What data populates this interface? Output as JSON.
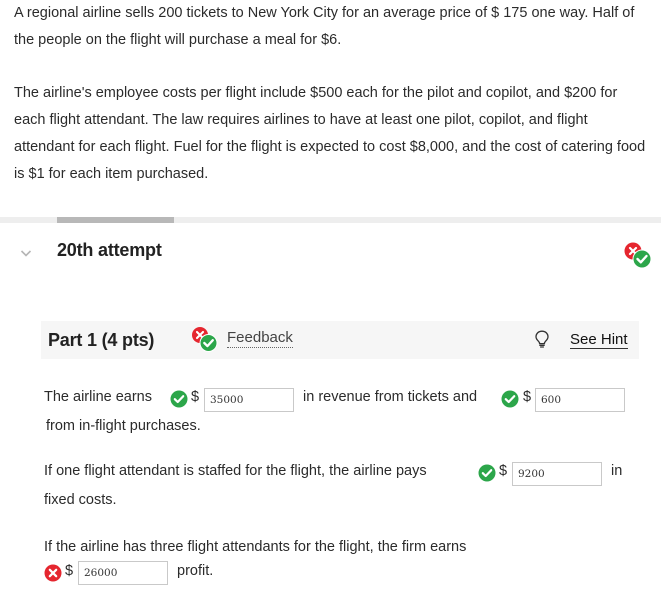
{
  "problem": {
    "paragraph1": "A regional airline sells 200 tickets to New York City for an average price of $ 175 one way. Half of the people on the flight will purchase a meal for $6.",
    "paragraph2": "The airline's employee costs per flight include $500 each for the pilot and copilot, and $200 for each flight attendant. The law requires airlines to have at least one pilot, copilot, and flight attendant for each flight. Fuel for the flight is expected to cost $8,000, and the cost of catering food is $1 for each item purchased."
  },
  "attempt": {
    "title": "20th attempt"
  },
  "part": {
    "title": "Part 1 (4 pts)",
    "feedback_label": "Feedback",
    "hint_label": "See Hint"
  },
  "questions": {
    "q1": {
      "prefix": "The airline earns",
      "currency": "$",
      "answer1": "35000",
      "middle": "in revenue from tickets and",
      "answer2": "600",
      "suffix": "from in-flight purchases."
    },
    "q2": {
      "prefix": "If one flight attendant is staffed for the flight, the airline pays",
      "currency": "$",
      "answer": "9200",
      "suffix_a": "in",
      "suffix_b": "fixed costs."
    },
    "q3": {
      "prefix": "If the airline has three flight attendants for the flight, the firm earns",
      "currency": "$",
      "answer": "26000",
      "suffix": "profit."
    }
  },
  "colors": {
    "correct": "#2ca64a",
    "incorrect": "#e5262f",
    "part_bar": "#f6f6f6",
    "divider": "#eeeeee"
  },
  "icons": [
    "chevron-down-icon",
    "status-mixed-icon",
    "check-circle-icon",
    "x-circle-icon",
    "lightbulb-icon"
  ]
}
